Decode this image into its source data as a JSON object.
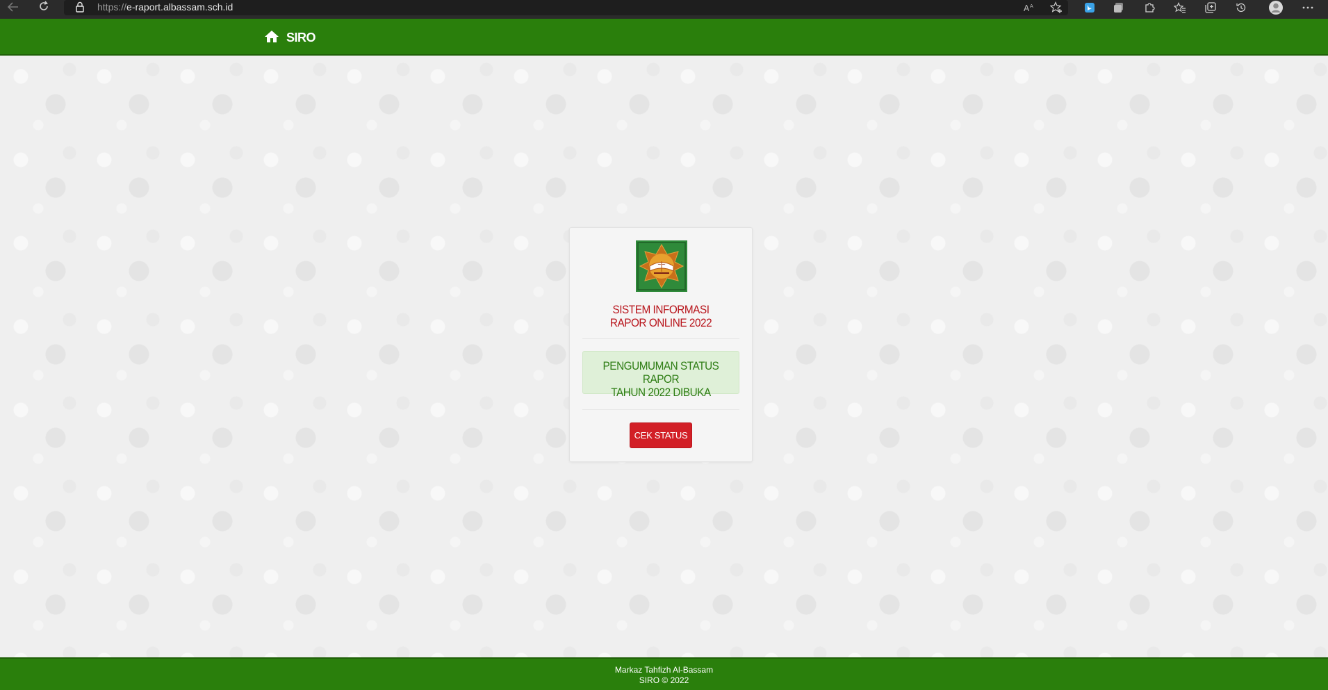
{
  "browser": {
    "url_protocol": "https://",
    "url_host": "e-raport.albassam.sch.id",
    "toolbar_icons": [
      "read-aloud-icon",
      "add-favorite-icon",
      "bing-extension-icon",
      "extension-icon",
      "extensions-puzzle-icon",
      "favorites-icon",
      "collections-icon",
      "history-icon",
      "profile-avatar-icon",
      "more-menu-icon"
    ]
  },
  "header": {
    "brand_label": "SIRO",
    "brand_icon": "home-icon",
    "background": "#2a7f0c"
  },
  "card": {
    "logo": "school-emblem-logo",
    "title_line1": "SISTEM INFORMASI",
    "title_line2": "RAPOR ONLINE 2022",
    "announcement_line1": "PENGUMUMAN STATUS RAPOR",
    "announcement_line2": "TAHUN 2022 DIBUKA",
    "button_label": "CEK STATUS"
  },
  "footer": {
    "line1": "Markaz Tahfizh Al-Bassam",
    "line2": "SIRO © 2022"
  },
  "colors": {
    "header_green": "#2a7f0c",
    "title_red": "#b8141b",
    "button_red": "#d21f26",
    "announce_bg": "#dff0d8",
    "announce_text": "#2e7d14"
  }
}
